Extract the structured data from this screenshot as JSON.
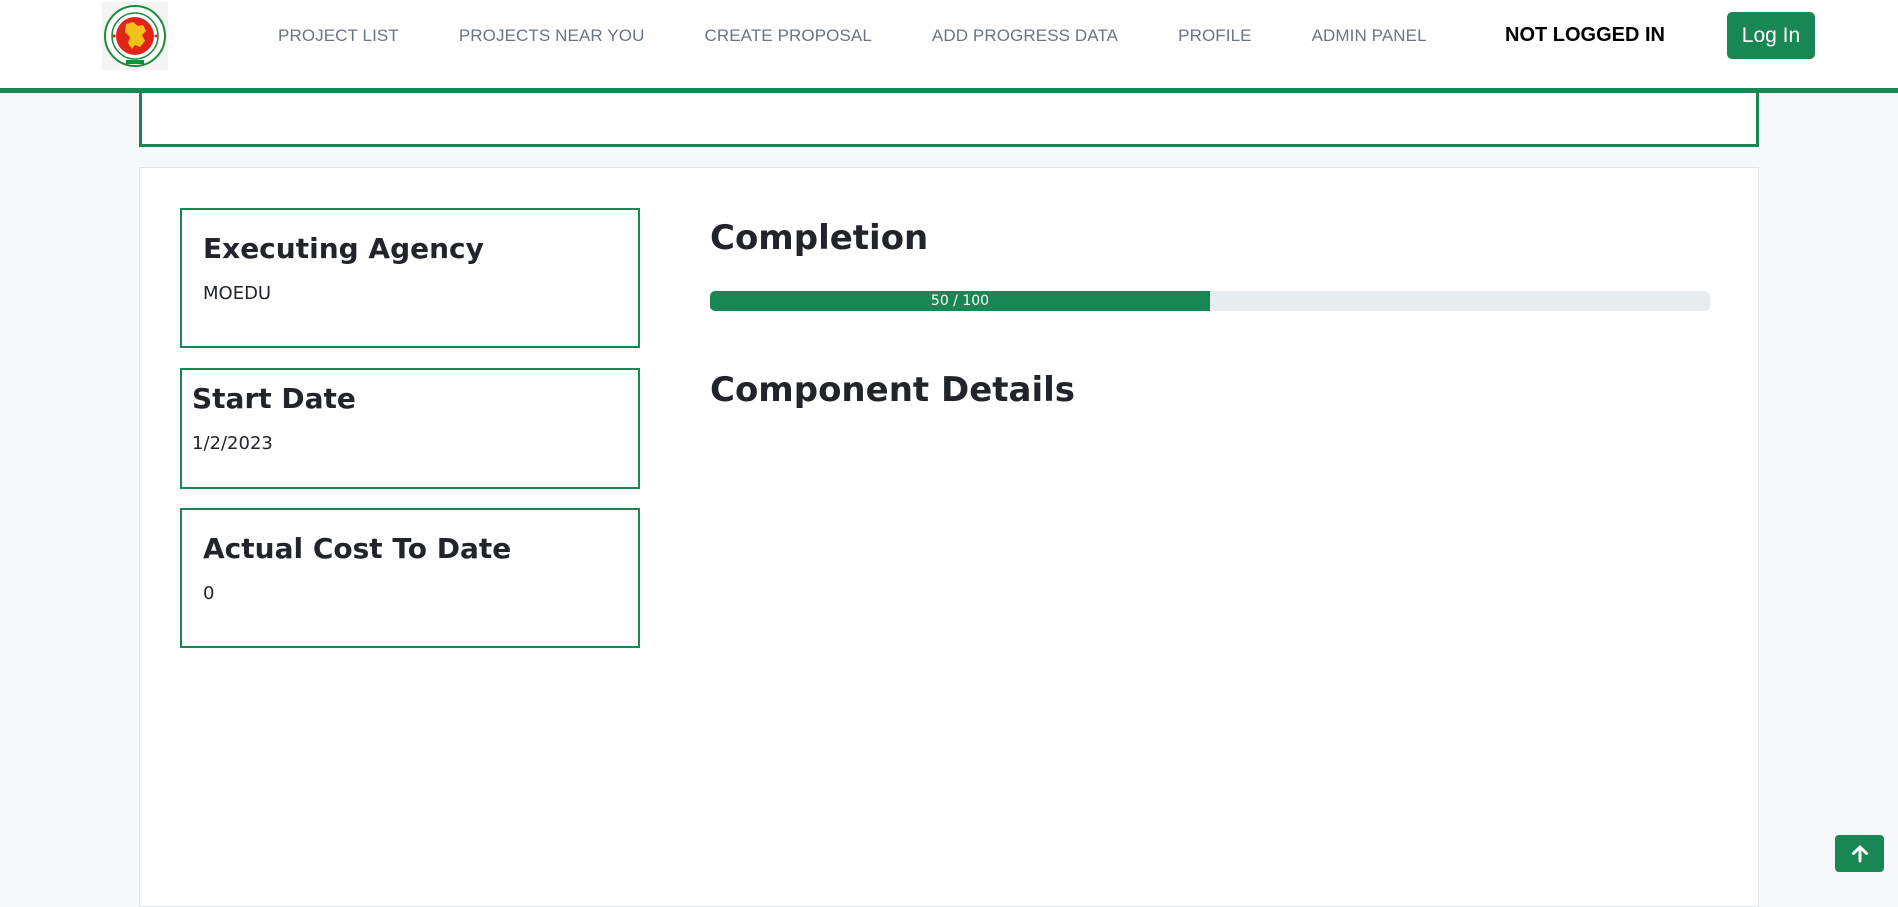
{
  "header": {
    "nav_items": [
      {
        "label": "PROJECT LIST"
      },
      {
        "label": "PROJECTS NEAR YOU"
      },
      {
        "label": "CREATE PROPOSAL"
      },
      {
        "label": "ADD PROGRESS DATA"
      },
      {
        "label": "PROFILE"
      },
      {
        "label": "ADMIN PANEL"
      }
    ],
    "auth_status": "NOT LOGGED IN",
    "login_label": "Log In",
    "logo_icon": "bangladesh-government-seal-icon"
  },
  "details": {
    "executing_agency": {
      "label": "Executing Agency",
      "value": "MOEDU"
    },
    "start_date": {
      "label": "Start Date",
      "value": "1/2/2023"
    },
    "actual_cost": {
      "label": "Actual Cost To Date",
      "value": "0"
    }
  },
  "completion": {
    "title": "Completion",
    "progress_text": "50 / 100",
    "progress_value": 50,
    "progress_max": 100
  },
  "components": {
    "title": "Component Details"
  },
  "back_to_top_icon": "arrow-up-icon",
  "colors": {
    "accent": "#198754",
    "progress_track": "#e9ecef",
    "page_background": "#f7f8f9"
  }
}
